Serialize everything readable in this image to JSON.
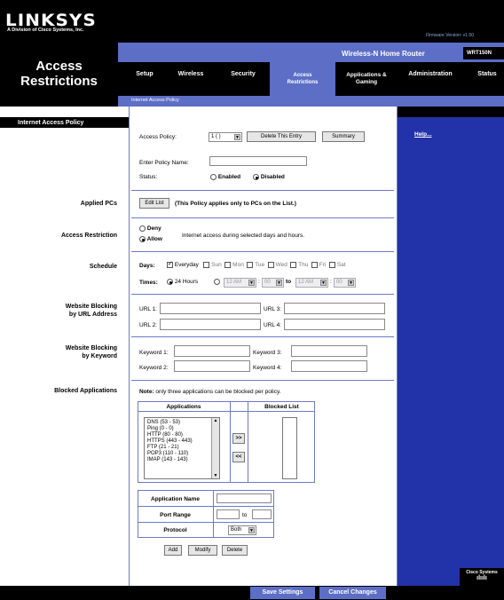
{
  "brand": {
    "logo": "LINKSYS",
    "sub": "A Division of Cisco Systems, Inc.",
    "firmware": "Firmware Version: v1.50"
  },
  "header": {
    "section_title_1": "Access",
    "section_title_2": "Restrictions",
    "product": "Wireless-N Home Router",
    "model": "WRT150N"
  },
  "tabs": [
    {
      "l1": "",
      "l2": "Setup"
    },
    {
      "l1": "",
      "l2": "Wireless"
    },
    {
      "l1": "",
      "l2": "Security"
    },
    {
      "l1": "Access",
      "l2": "Restrictions"
    },
    {
      "l1": "Applications &",
      "l2": "Gaming"
    },
    {
      "l1": "",
      "l2": "Administration"
    },
    {
      "l1": "",
      "l2": "Status"
    }
  ],
  "subtab": "Internet Access Policy",
  "sidebar": {
    "header": "Internet Access Policy",
    "applied_pcs": "Applied PCs",
    "access_restriction": "Access Restriction",
    "schedule": "Schedule",
    "wb_url_1": "Website Blocking",
    "wb_url_2": "by URL Address",
    "wb_kw_1": "Website Blocking",
    "wb_kw_2": "by Keyword",
    "blocked_apps": "Blocked Applications"
  },
  "policy": {
    "label": "Access Policy:",
    "selected": "1 ( )",
    "delete_btn": "Delete This Entry",
    "summary_btn": "Summary",
    "name_label": "Enter Policy Name:",
    "name_value": "",
    "status_label": "Status:",
    "enabled": "Enabled",
    "disabled": "Disabled"
  },
  "applied": {
    "edit_btn": "Edit List",
    "note": "(This Policy applies only to PCs on the List.)"
  },
  "restriction": {
    "deny": "Deny",
    "allow": "Allow",
    "desc": "Internet access during selected days and hours."
  },
  "schedule": {
    "days_label": "Days:",
    "days": [
      "Everyday",
      "Sun",
      "Mon",
      "Tue",
      "Wed",
      "Thu",
      "Fri",
      "Sat"
    ],
    "times_label": "Times:",
    "hours24": "24 Hours",
    "h1": "12 AM",
    "m1": "00",
    "to": "to",
    "h2": "12 AM",
    "m2": "00"
  },
  "urls": {
    "u1": "URL 1:",
    "u2": "URL 2:",
    "u3": "URL 3:",
    "u4": "URL 4:"
  },
  "keywords": {
    "k1": "Keyword 1:",
    "k2": "Keyword 2:",
    "k3": "Keyword 3:",
    "k4": "Keyword 4:"
  },
  "apps": {
    "note_bold": "Note:",
    "note": " only three applications can be blocked per policy.",
    "col_apps": "Applications",
    "col_blocked": "Blocked List",
    "list": [
      "DNS   (53 - 53)",
      "Ping   (0 - 0)",
      "HTTP   (80 - 80)",
      "HTTPS   (443 - 443)",
      "FTP   (21 - 21)",
      "POP3   (110 - 110)",
      "IMAP   (143 - 143)"
    ],
    "add_arrow": ">>",
    "remove_arrow": "<<",
    "app_name_label": "Application Name",
    "port_range_label": "Port Range",
    "to": "to",
    "protocol_label": "Protocol",
    "protocol_value": "Both",
    "add_btn": "Add",
    "modify_btn": "Modify",
    "delete_btn": "Delete"
  },
  "right": {
    "help": "Help..."
  },
  "footer": {
    "save": "Save Settings",
    "cancel": "Cancel Changes",
    "cisco": "Cisco Systems"
  }
}
